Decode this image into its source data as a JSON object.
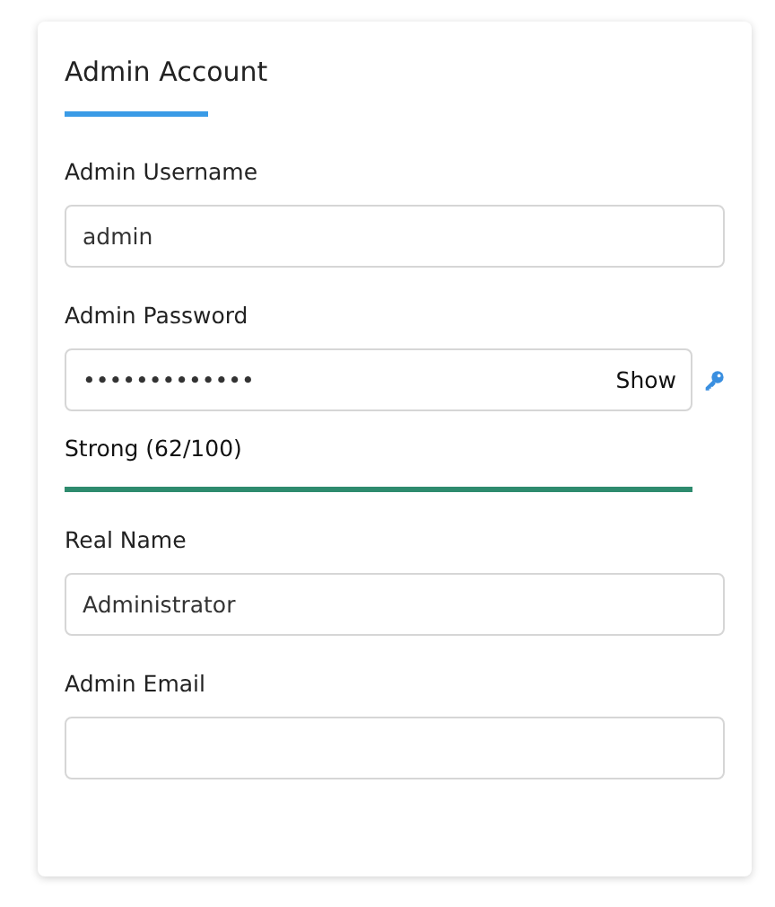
{
  "card": {
    "title": "Admin Account"
  },
  "fields": [
    {
      "kind": "text",
      "label": "Admin Username",
      "value": "admin"
    },
    {
      "kind": "password",
      "label": "Admin Password",
      "value": "•••••••••••••",
      "toggle": "Show",
      "strength": {
        "text": "Strong (62/100)",
        "level": 1,
        "color": "#2e8b6e"
      }
    },
    {
      "kind": "text",
      "label": "Real Name",
      "value": "Administrator"
    },
    {
      "kind": "text",
      "label": "Admin Email"
    }
  ]
}
